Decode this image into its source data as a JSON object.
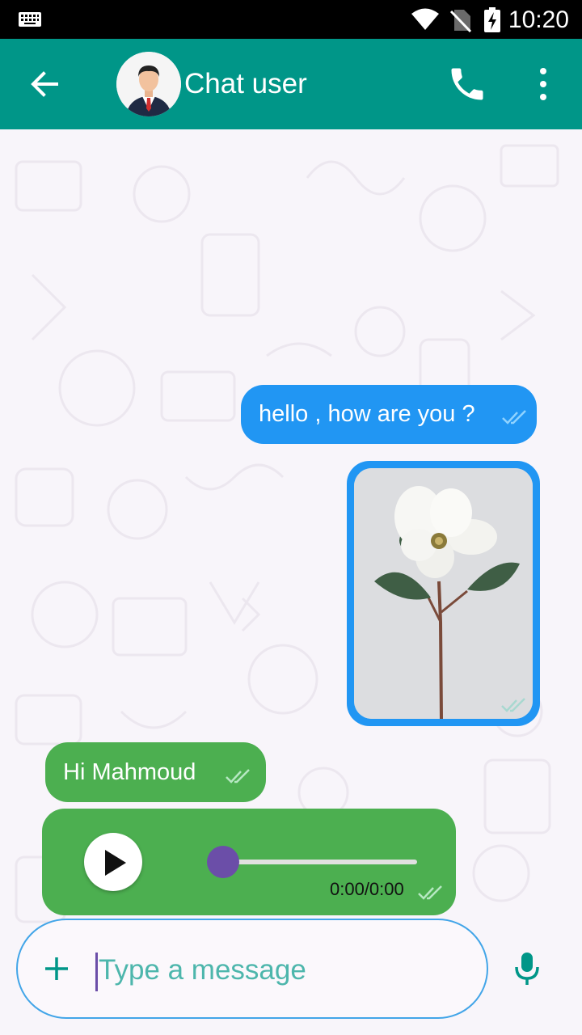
{
  "status_bar": {
    "time": "10:20",
    "icons": [
      "keyboard-icon",
      "wifi-icon",
      "no-signal-icon",
      "battery-charging-icon"
    ]
  },
  "app_bar": {
    "title": "Chat user",
    "icons": [
      "back-arrow-icon",
      "phone-icon",
      "more-vert-icon"
    ],
    "color": "#009688"
  },
  "messages": [
    {
      "type": "text",
      "direction": "outgoing",
      "text": "hello , how are you ?",
      "status": "double-check",
      "color": "#2196f3"
    },
    {
      "type": "image",
      "direction": "outgoing",
      "subject": "flower-image",
      "status": "double-check",
      "color": "#2196f3"
    },
    {
      "type": "text",
      "direction": "incoming",
      "text": "Hi Mahmoud",
      "status": "double-check",
      "color": "#4caf50"
    },
    {
      "type": "audio",
      "direction": "incoming",
      "time": "0:00/0:00",
      "progress": 0,
      "status": "double-check",
      "color": "#4caf50"
    }
  ],
  "composer": {
    "placeholder": "Type a message",
    "value": "",
    "icons": [
      "add-icon",
      "mic-icon"
    ],
    "accent": "#42a5e8"
  }
}
